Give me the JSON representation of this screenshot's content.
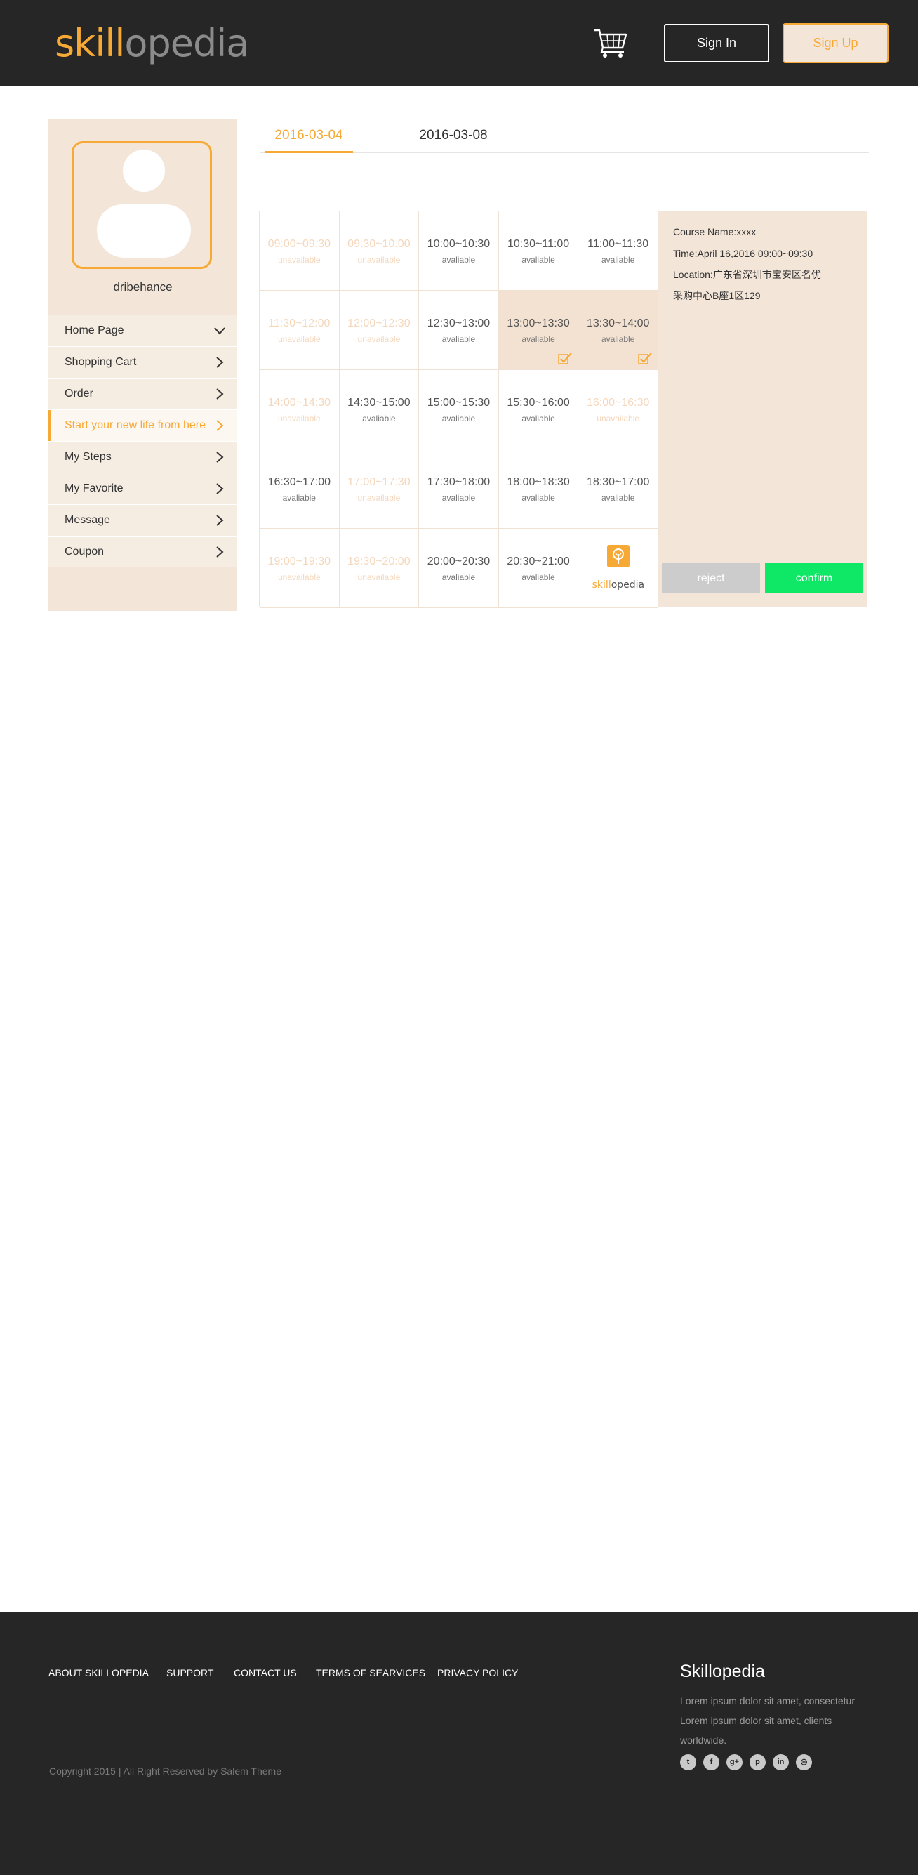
{
  "header": {
    "logo_part1": "skill",
    "logo_part2": "opedia",
    "cart_icon": "shopping-cart-icon",
    "signin_label": "Sign In",
    "signup_label": "Sign Up"
  },
  "sidebar": {
    "username": "dribehance",
    "items": [
      {
        "label": "Home Page",
        "icon": "chevron-down-icon"
      },
      {
        "label": "Shopping Cart",
        "icon": "chevron-right-icon"
      },
      {
        "label": "Order",
        "icon": "chevron-right-icon"
      },
      {
        "label": "Start your new life from here",
        "icon": "chevron-right-icon",
        "active": true
      },
      {
        "label": "My Steps",
        "icon": "chevron-right-icon"
      },
      {
        "label": "My Favorite",
        "icon": "chevron-right-icon"
      },
      {
        "label": "Message",
        "icon": "chevron-right-icon"
      },
      {
        "label": "Coupon",
        "icon": "chevron-right-icon"
      }
    ]
  },
  "tabs": [
    {
      "label": "2016-03-04",
      "active": true
    },
    {
      "label": "2016-03-08",
      "active": false
    }
  ],
  "slots": [
    {
      "time": "09:00~09:30",
      "status": "unavailable"
    },
    {
      "time": "09:30~10:00",
      "status": "unavailable"
    },
    {
      "time": "10:00~10:30",
      "status": "avaliable"
    },
    {
      "time": "10:30~11:00",
      "status": "avaliable"
    },
    {
      "time": "11:00~11:30",
      "status": "avaliable"
    },
    {
      "time": "11:30~12:00",
      "status": "unavailable"
    },
    {
      "time": "12:00~12:30",
      "status": "unavailable"
    },
    {
      "time": "12:30~13:00",
      "status": "avaliable"
    },
    {
      "time": "13:00~13:30",
      "status": "avaliable",
      "selected": true
    },
    {
      "time": "13:30~14:00",
      "status": "avaliable",
      "selected": true
    },
    {
      "time": "14:00~14:30",
      "status": "unavailable"
    },
    {
      "time": "14:30~15:00",
      "status": "avaliable"
    },
    {
      "time": "15:00~15:30",
      "status": "avaliable"
    },
    {
      "time": "15:30~16:00",
      "status": "avaliable"
    },
    {
      "time": "16:00~16:30",
      "status": "unavailable"
    },
    {
      "time": "16:30~17:00",
      "status": "avaliable"
    },
    {
      "time": "17:00~17:30",
      "status": "unavailable"
    },
    {
      "time": "17:30~18:00",
      "status": "avaliable"
    },
    {
      "time": "18:00~18:30",
      "status": "avaliable"
    },
    {
      "time": "18:30~17:00",
      "status": "avaliable"
    },
    {
      "time": "19:00~19:30",
      "status": "unavailable"
    },
    {
      "time": "19:30~20:00",
      "status": "unavailable"
    },
    {
      "time": "20:00~20:30",
      "status": "avaliable"
    },
    {
      "time": "20:30~21:00",
      "status": "avaliable"
    }
  ],
  "grid_logo": {
    "part1": "skill",
    "part2": "opedia"
  },
  "detail": {
    "course_name": "Course Name:xxxx",
    "time": "Time:April 16,2016 09:00~09:30",
    "location_line1": "Location:广东省深圳市宝安区名优",
    "location_line2": "采购中心B座1区129",
    "reject_label": "reject",
    "confirm_label": "confirm"
  },
  "footer": {
    "nav": [
      "ABOUT SKILLOPEDIA",
      "SUPPORT",
      "CONTACT US",
      "TERMS OF SEARVICES",
      "PRIVACY POLICY"
    ],
    "copyright": "Copyright 2015 | All Right Reserved by Salem Theme",
    "brand": "Skillopedia",
    "description": "Lorem ipsum dolor sit amet, consectetur Lorem ipsum dolor sit amet,  clients worldwide.",
    "social": [
      "twitter-icon",
      "facebook-icon",
      "google-plus-icon",
      "pinterest-icon",
      "linkedin-icon",
      "dribbble-icon"
    ]
  },
  "colors": {
    "accent": "#f7a936",
    "header_bg": "#262626",
    "panel_bg": "#f3e6d9",
    "confirm": "#0ee866",
    "reject": "#cccccc"
  }
}
